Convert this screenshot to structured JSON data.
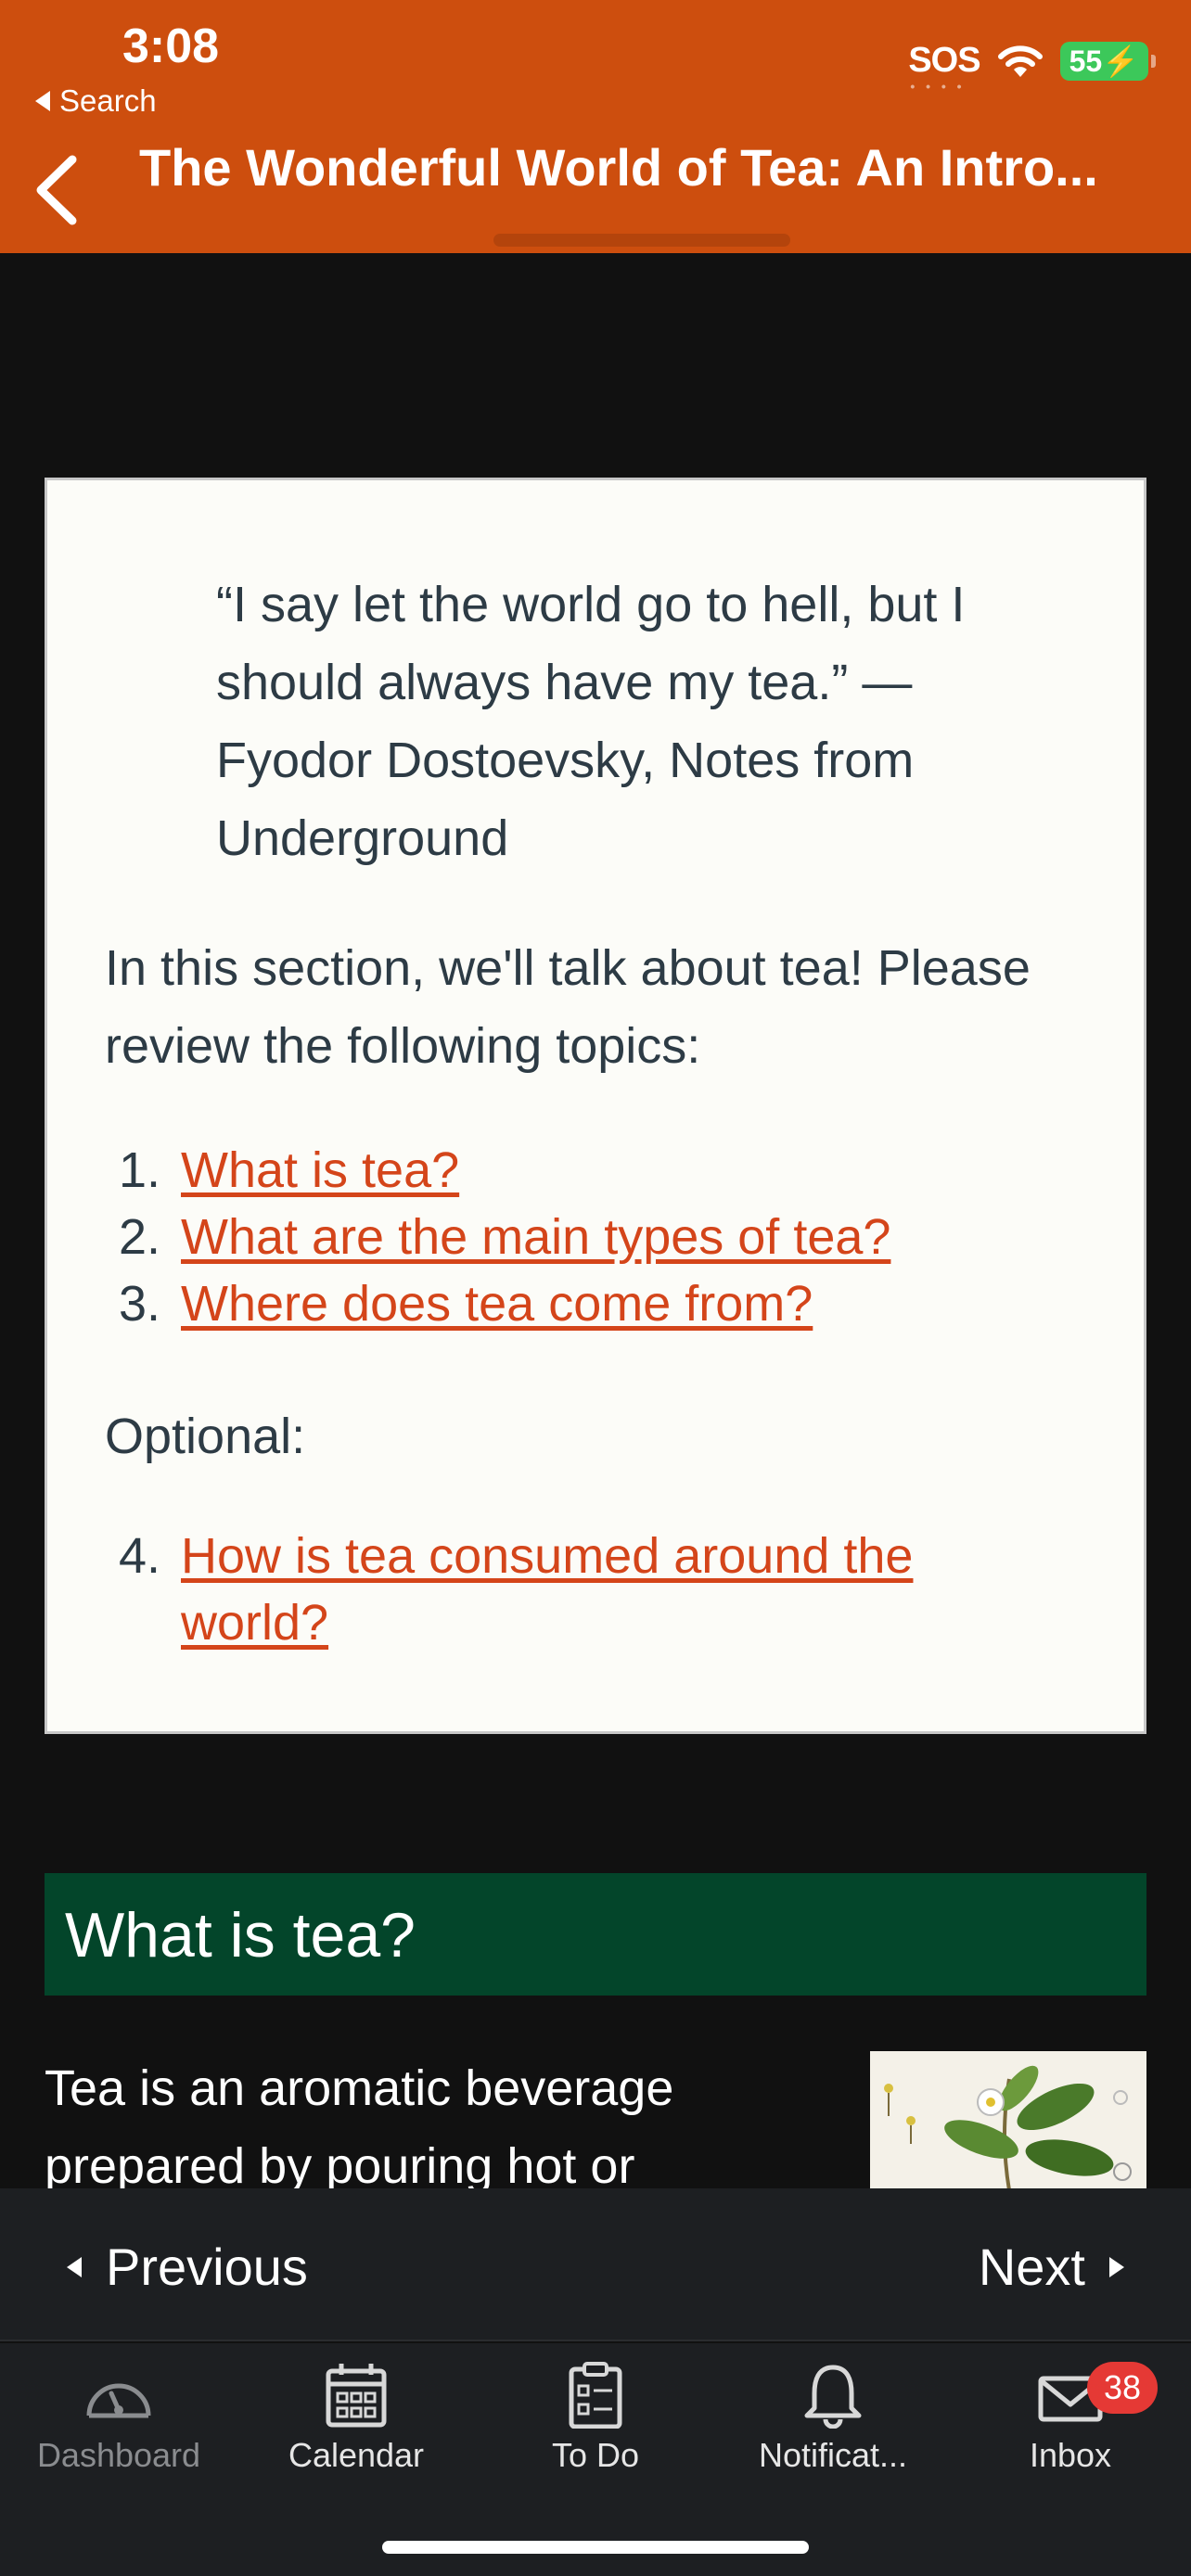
{
  "status_bar": {
    "time": "3:08",
    "back_app": "Search",
    "carrier": "SOS",
    "battery": "55"
  },
  "header": {
    "title": "The Wonderful World of Tea: An Intro..."
  },
  "card": {
    "quote": "“I say let the world go to hell, but I should always have my tea.” — Fyodor Dostoevsky, Notes from Underground",
    "intro": "In this section, we'll talk about tea! Please review the following topics:",
    "topics": [
      {
        "num": "1.",
        "label": "What is tea?"
      },
      {
        "num": "2.",
        "label": "What are the main types of tea?"
      },
      {
        "num": "3.",
        "label": "Where does tea come from?"
      }
    ],
    "optional_label": "Optional:",
    "optional_topic": {
      "num": "4.",
      "line1": "How is tea consumed around the",
      "line2": "world?"
    }
  },
  "section": {
    "title": "What is tea?",
    "body": "Tea is an aromatic beverage prepared by pouring hot or"
  },
  "pager": {
    "previous": "Previous",
    "next": "Next"
  },
  "tabbar": {
    "items": [
      {
        "label": "Dashboard",
        "icon": "dashboard-icon"
      },
      {
        "label": "Calendar",
        "icon": "calendar-icon"
      },
      {
        "label": "To Do",
        "icon": "todo-icon"
      },
      {
        "label": "Notificat...",
        "icon": "bell-icon"
      },
      {
        "label": "Inbox",
        "icon": "mail-icon"
      }
    ],
    "inbox_badge": "38"
  },
  "colors": {
    "header": "#cd4e0e",
    "link": "#d4451a",
    "section_banner": "#03452a",
    "badge": "#e53935"
  }
}
